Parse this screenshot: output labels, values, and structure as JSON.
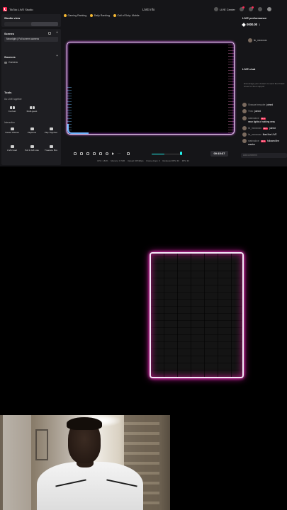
{
  "titlebar": {
    "app_name": "TikTok LIVE Studio",
    "center": "LIVE Info",
    "live_center": "LIVE Center"
  },
  "studio_view": {
    "title": "Studio view"
  },
  "scenes": {
    "title": "Scenes",
    "current": "Neonlight | Full screen camera"
  },
  "sources": {
    "title": "Sources",
    "items": [
      "Camera"
    ]
  },
  "tools": {
    "title": "Tools",
    "go_live_together": "Go LIVE together",
    "co_host": "Co-host",
    "multi_guest": "Multi-guest",
    "interaction": "Interaction",
    "viewer_wishes": "Viewer Wishes",
    "playbook": "Playbook",
    "play_together": "Play Together",
    "live_goal": "LIVE Goal",
    "poll_gift_vote": "Poll & Gift vote",
    "treasure_box": "Treasure Box"
  },
  "rankings": [
    "Gaming Ranking",
    "Daily Ranking",
    "Call of Duty: Mobile"
  ],
  "controls": {
    "timer": "00:15:37",
    "volume_level": 0.45
  },
  "stats": [
    "CPU: 1.82%",
    "Memory: 0.7GB",
    "Upload: 3974kbps",
    "Frame drops: 0",
    "Rendered FPS: 60",
    "FPS: 30"
  ],
  "right_panel": {
    "performance_title": "LIVE performance",
    "earnings": "0000.00",
    "viewers_count": "1",
    "top_gifter": "lin_mxxxxxxx",
    "chat_title": "LIVE chat",
    "chat_empty": "Encourage your viewers to send their blank cheer for their support",
    "add_comment_placeholder": "Add comment",
    "messages": [
      {
        "user": "Shawae bessobe",
        "badge": "",
        "text": "joined"
      },
      {
        "user": "Theo",
        "badge": "",
        "text": "joined"
      },
      {
        "user": "marinalove",
        "badge": "No 1",
        "text": ""
      },
      {
        "user": "",
        "badge": "",
        "text": "neon lights of nothing ness"
      },
      {
        "user": "lin_mxxxxxxx",
        "badge": "No 1",
        "text": "joined"
      },
      {
        "user": "lin_mxxxxxxx",
        "badge": "",
        "text": "liked the LIVE"
      },
      {
        "user": "marinalove",
        "badge": "No 1",
        "text": "followed the"
      },
      {
        "user": "",
        "badge": "",
        "text": "creator"
      }
    ]
  },
  "colors": {
    "accent": "#fe2c55",
    "cyan": "#25f4ee",
    "neon_pink": "#ff3cc8"
  }
}
